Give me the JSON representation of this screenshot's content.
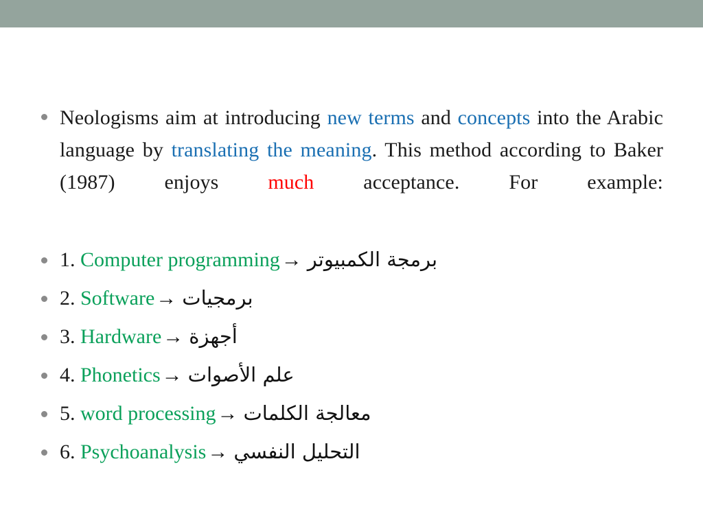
{
  "slide": {
    "band_color": "#94a49d",
    "background_color": "#ffffff",
    "accent_colors": {
      "blue": "#1a6fb2",
      "red": "#ff0000",
      "green": "#0aa05a",
      "text": "#1a1a1a",
      "bullet": "#8a8a8a"
    }
  },
  "paragraph": {
    "seg1": "Neologisms aim at introducing ",
    "kw_new_terms": "new terms",
    "seg2": " and ",
    "kw_concepts": "concepts",
    "seg3": " into the Arabic language by ",
    "kw_translating": "translating the meaning",
    "seg4": ". This method according to Baker (1987) enjoys ",
    "kw_much": "much",
    "seg5": " acceptance. For example:"
  },
  "terms": {
    "arrow": "→",
    "items": [
      {
        "number": "1.",
        "english": "Computer programming",
        "arabic": "برمجة الكمبيوتر"
      },
      {
        "number": "2.",
        "english": "Software",
        "arabic": "برمجيات"
      },
      {
        "number": "3.",
        "english": "Hardware",
        "arabic": "أجهزة"
      },
      {
        "number": "4.",
        "english": "Phonetics",
        "arabic": "علم الأصوات"
      },
      {
        "number": "5.",
        "english": "word processing",
        "arabic": "معالجة الكلمات"
      },
      {
        "number": "6.",
        "english": "Psychoanalysis",
        "arabic": "التحليل النفسي"
      }
    ]
  }
}
